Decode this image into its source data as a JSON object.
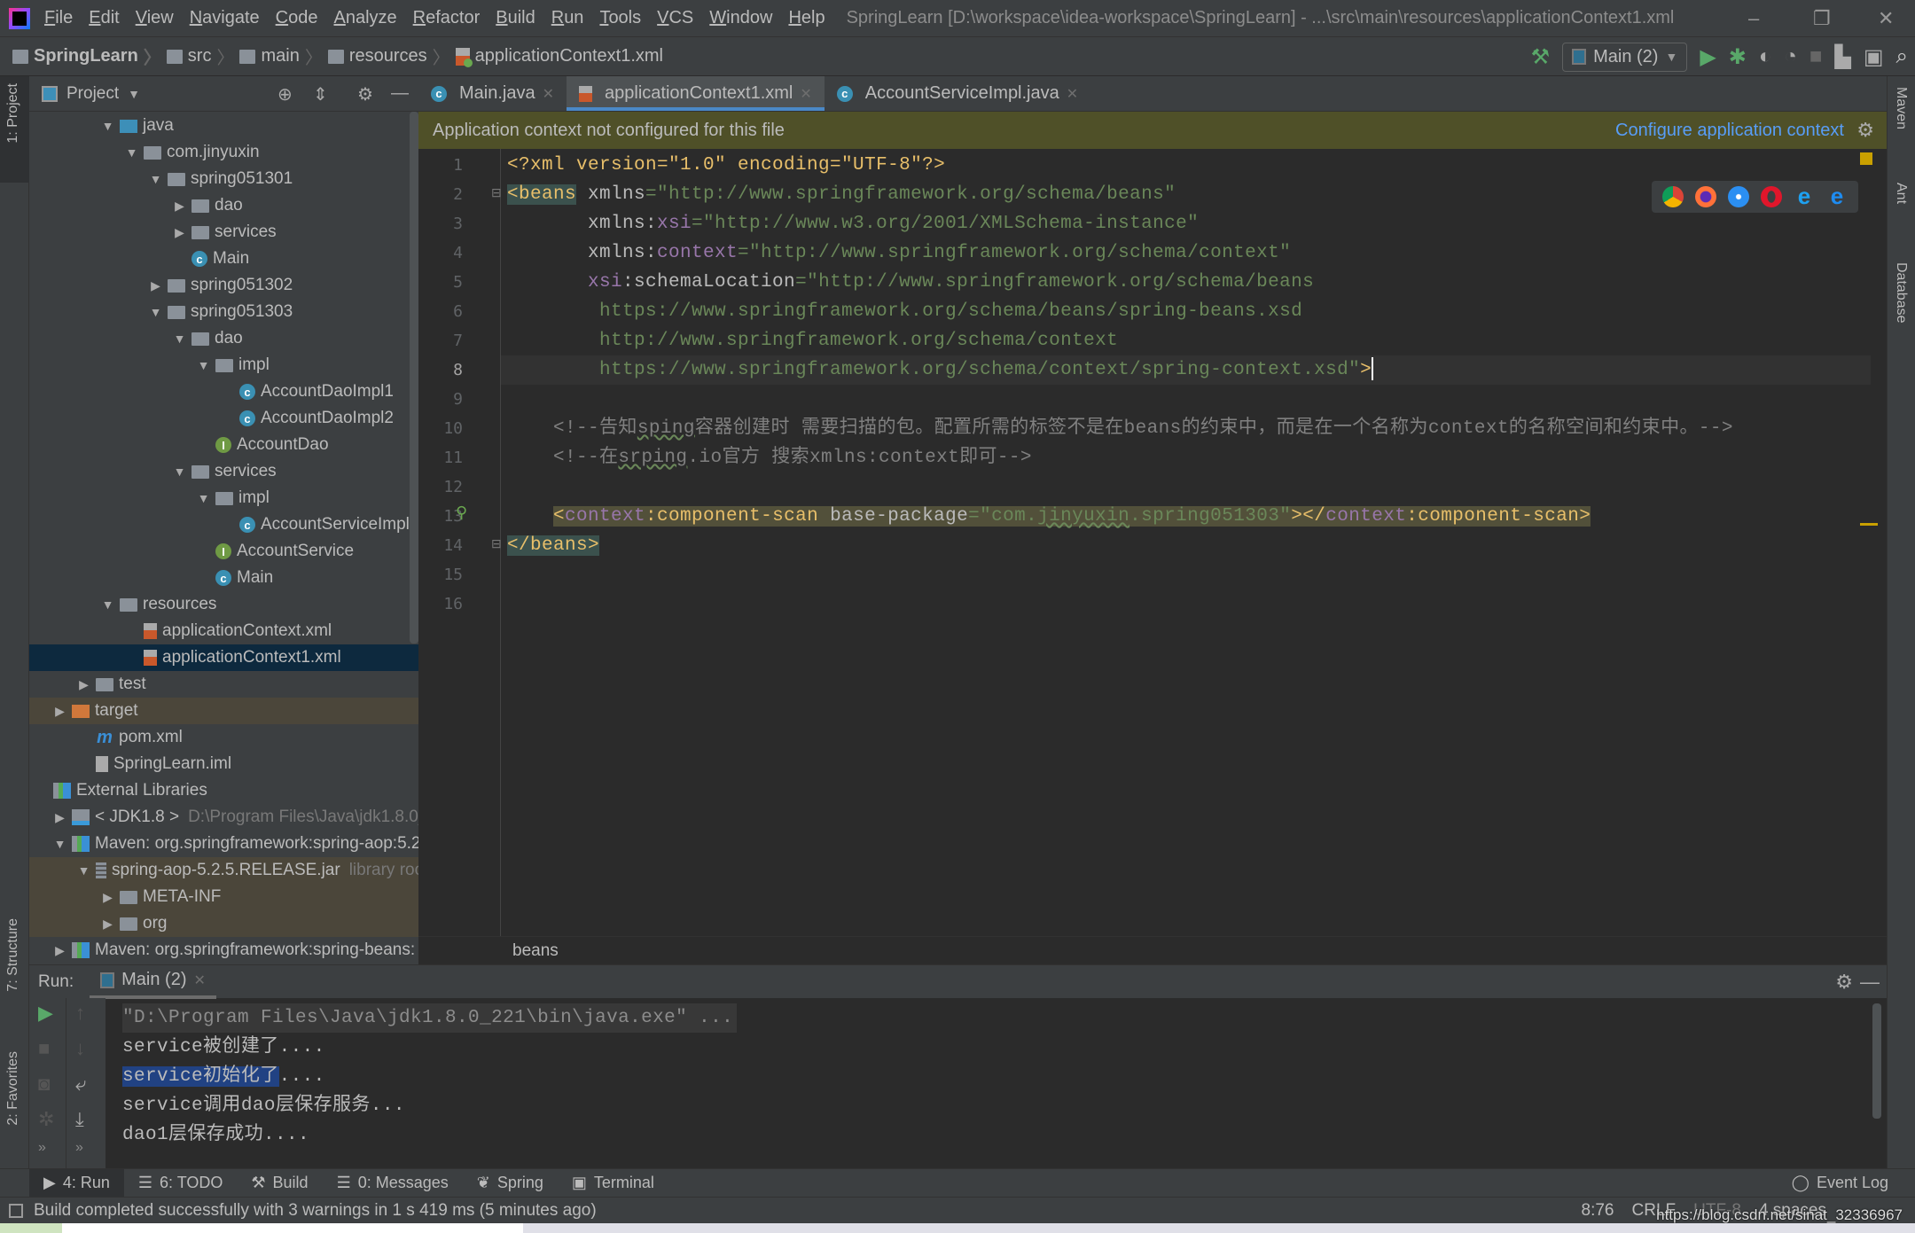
{
  "menubar": {
    "items": [
      "File",
      "Edit",
      "View",
      "Navigate",
      "Code",
      "Analyze",
      "Refactor",
      "Build",
      "Run",
      "Tools",
      "VCS",
      "Window",
      "Help"
    ],
    "title": "SpringLearn [D:\\workspace\\idea-workspace\\SpringLearn] - ...\\src\\main\\resources\\applicationContext1.xml"
  },
  "breadcrumbs": [
    "SpringLearn",
    "src",
    "main",
    "resources",
    "applicationContext1.xml"
  ],
  "toolbar": {
    "run_config": "Main (2)"
  },
  "left_stripe": {
    "project": "1: Project",
    "structure": "7: Structure",
    "favorites": "2: Favorites"
  },
  "right_stripe": {
    "maven": "Maven",
    "ant": "Ant",
    "database": "Database"
  },
  "project": {
    "title": "Project",
    "tree": [
      {
        "d": 2,
        "arrow": "open",
        "icon": "folder-blue",
        "label": "java"
      },
      {
        "d": 3,
        "arrow": "open",
        "icon": "folder",
        "label": "com.jinyuxin"
      },
      {
        "d": 4,
        "arrow": "open",
        "icon": "folder",
        "label": "spring051301"
      },
      {
        "d": 5,
        "arrow": "closed",
        "icon": "folder",
        "label": "dao"
      },
      {
        "d": 5,
        "arrow": "closed",
        "icon": "folder",
        "label": "services"
      },
      {
        "d": 5,
        "arrow": "",
        "icon": "class",
        "label": "Main"
      },
      {
        "d": 4,
        "arrow": "closed",
        "icon": "folder",
        "label": "spring051302"
      },
      {
        "d": 4,
        "arrow": "open",
        "icon": "folder",
        "label": "spring051303"
      },
      {
        "d": 5,
        "arrow": "open",
        "icon": "folder",
        "label": "dao"
      },
      {
        "d": 6,
        "arrow": "open",
        "icon": "folder",
        "label": "impl"
      },
      {
        "d": 7,
        "arrow": "",
        "icon": "class",
        "label": "AccountDaoImpl1"
      },
      {
        "d": 7,
        "arrow": "",
        "icon": "class",
        "label": "AccountDaoImpl2"
      },
      {
        "d": 6,
        "arrow": "",
        "icon": "interface",
        "label": "AccountDao"
      },
      {
        "d": 5,
        "arrow": "open",
        "icon": "folder",
        "label": "services"
      },
      {
        "d": 6,
        "arrow": "open",
        "icon": "folder",
        "label": "impl"
      },
      {
        "d": 7,
        "arrow": "",
        "icon": "class",
        "label": "AccountServiceImpl"
      },
      {
        "d": 6,
        "arrow": "",
        "icon": "interface",
        "label": "AccountService"
      },
      {
        "d": 6,
        "arrow": "",
        "icon": "class",
        "label": "Main"
      },
      {
        "d": 2,
        "arrow": "open",
        "icon": "folder",
        "label": "resources"
      },
      {
        "d": 3,
        "arrow": "",
        "icon": "xml",
        "label": "applicationContext.xml"
      },
      {
        "d": 3,
        "arrow": "",
        "icon": "xml",
        "label": "applicationContext1.xml",
        "selected": true
      },
      {
        "d": 1,
        "arrow": "closed",
        "icon": "folder",
        "label": "test"
      },
      {
        "d": 0,
        "arrow": "closed",
        "icon": "folder-orange",
        "label": "target",
        "excluded": true
      },
      {
        "d": 1,
        "arrow": "",
        "icon": "maven",
        "label": "pom.xml"
      },
      {
        "d": 1,
        "arrow": "",
        "icon": "iml",
        "label": "SpringLearn.iml"
      },
      {
        "d": -1,
        "arrow": "",
        "icon": "lib",
        "label": "External Libraries"
      },
      {
        "d": 0,
        "arrow": "closed",
        "icon": "jdk",
        "label": "< JDK1.8 >",
        "extra": "D:\\Program Files\\Java\\jdk1.8.0_"
      },
      {
        "d": 0,
        "arrow": "open",
        "icon": "lib",
        "label": "Maven: org.springframework:spring-aop:5.2"
      },
      {
        "d": 1,
        "arrow": "open",
        "icon": "jar",
        "label": "spring-aop-5.2.5.RELEASE.jar",
        "extra": "library root",
        "lib": true
      },
      {
        "d": 2,
        "arrow": "closed",
        "icon": "folder",
        "label": "META-INF",
        "lib": true
      },
      {
        "d": 2,
        "arrow": "closed",
        "icon": "folder",
        "label": "org",
        "lib": true
      },
      {
        "d": 0,
        "arrow": "closed",
        "icon": "lib",
        "label": "Maven: org.springframework:spring-beans:"
      }
    ]
  },
  "editor": {
    "tabs": [
      {
        "label": "Main.java",
        "icon": "class"
      },
      {
        "label": "applicationContext1.xml",
        "icon": "xml",
        "active": true
      },
      {
        "label": "AccountServiceImpl.java",
        "icon": "class"
      }
    ],
    "notification": "Application context not configured for this file",
    "notification_link": "Configure application context",
    "current_line": 8,
    "lines": [
      [
        {
          "t": "<?xml version=\"1.0\" encoding=\"UTF-8\"?>",
          "k": "tag"
        }
      ],
      [
        {
          "t": "<beans",
          "k": "tag",
          "hl": "beans"
        },
        {
          "t": " xmlns",
          "k": "attr"
        },
        {
          "t": "=\"http://www.springframework.org/schema/beans\"",
          "k": "str"
        }
      ],
      [
        {
          "t": "       xmlns:",
          "k": "attr"
        },
        {
          "t": "xsi",
          "k": "ns"
        },
        {
          "t": "=\"http://www.w3.org/2001/XMLSchema-instance\"",
          "k": "str"
        }
      ],
      [
        {
          "t": "       xmlns:",
          "k": "attr"
        },
        {
          "t": "context",
          "k": "ns"
        },
        {
          "t": "=\"http://www.springframework.org/schema/context\"",
          "k": "str"
        }
      ],
      [
        {
          "t": "       xsi",
          "k": "ns"
        },
        {
          "t": ":schemaLocation",
          "k": "attr"
        },
        {
          "t": "=\"http://www.springframework.org/schema/beans",
          "k": "str"
        }
      ],
      [
        {
          "t": "        https://www.springframework.org/schema/beans/spring-beans.xsd",
          "k": "str"
        }
      ],
      [
        {
          "t": "        http://www.springframework.org/schema/context",
          "k": "str"
        }
      ],
      [
        {
          "t": "        https://www.springframework.org/schema/context/spring-context.xsd\"",
          "k": "str"
        },
        {
          "t": ">",
          "k": "tag"
        }
      ],
      [],
      [
        {
          "t": "    <!--告知",
          "k": "com"
        },
        {
          "t": "sping",
          "k": "com",
          "squig": true
        },
        {
          "t": "容器创建时 需要扫描的包。配置所需的标签不是在beans的约束中，而是在一个名称为context的名称空间和约束中。-->",
          "k": "com"
        }
      ],
      [
        {
          "t": "    <!--在",
          "k": "com"
        },
        {
          "t": "srping",
          "k": "com",
          "squig": true
        },
        {
          "t": ".io官方 搜索xmlns:context即可-->",
          "k": "com"
        }
      ],
      [],
      [
        {
          "t": "    ",
          "k": "plain"
        },
        {
          "t": "<",
          "k": "tag",
          "hl": "13"
        },
        {
          "t": "context",
          "k": "ns",
          "hl": "13"
        },
        {
          "t": ":component-scan ",
          "k": "tag",
          "hl": "13"
        },
        {
          "t": "base-package",
          "k": "attr",
          "hl": "13"
        },
        {
          "t": "=\"com.",
          "k": "str",
          "hl": "13"
        },
        {
          "t": "jinyuxin",
          "k": "str",
          "hl": "13",
          "squig": true
        },
        {
          "t": ".spring051303\"",
          "k": "str",
          "hl": "13"
        },
        {
          "t": "></",
          "k": "tag",
          "hl": "13"
        },
        {
          "t": "context",
          "k": "ns",
          "hl": "13"
        },
        {
          "t": ":component-scan>",
          "k": "tag",
          "hl": "13"
        }
      ],
      [
        {
          "t": "</beans>",
          "k": "tag",
          "hl": "beans"
        }
      ],
      [],
      []
    ],
    "breadcrumb": "beans"
  },
  "run": {
    "label": "Run:",
    "tab": "Main (2)",
    "console": [
      {
        "text": "\"D:\\Program Files\\Java\\jdk1.8.0_221\\bin\\java.exe\" ...",
        "cmd": true
      },
      {
        "text": "service被创建了...."
      },
      {
        "sel": "service初始化了",
        "text": "...."
      },
      {
        "text": "service调用dao层保存服务..."
      },
      {
        "text": "dao1层保存成功...."
      }
    ]
  },
  "toolwindows": [
    {
      "label": "4: Run",
      "icon": "▶",
      "active": true
    },
    {
      "label": "6: TODO",
      "icon": "☰"
    },
    {
      "label": "Build",
      "icon": "⚒"
    },
    {
      "label": "0: Messages",
      "icon": "☰"
    },
    {
      "label": "Spring",
      "icon": "❦"
    },
    {
      "label": "Terminal",
      "icon": "▣"
    }
  ],
  "event_log": "Event Log",
  "status": {
    "message": "Build completed successfully with 3 warnings in 1 s 419 ms (5 minutes ago)",
    "position": "8:76",
    "line_sep": "CRLF",
    "encoding": "UTF-8",
    "indent": "4 spaces",
    "watermark": "https://blog.csdn.net/sinat_32336967"
  },
  "colors": {
    "accent": "#4a88c7",
    "link": "#589df6",
    "notification_bg": "#4f5028",
    "selection": "#214283"
  }
}
